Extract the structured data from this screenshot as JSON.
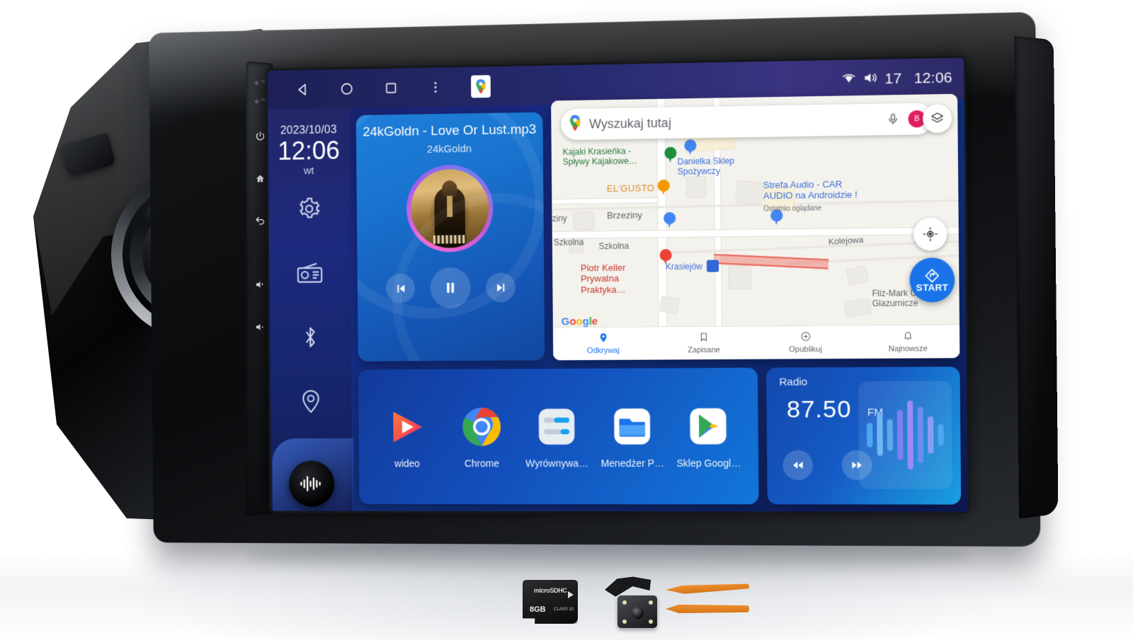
{
  "device": {
    "type": "android-car-head-unit",
    "hardware_buttons": [
      {
        "name": "power-button",
        "glyph": "⏻"
      },
      {
        "name": "home-button",
        "glyph": "⌂"
      },
      {
        "name": "back-button",
        "glyph": "↺"
      },
      {
        "name": "volume-up-button",
        "glyph": "🔊+"
      },
      {
        "name": "volume-down-button",
        "glyph": "🔈-"
      }
    ],
    "mic_label": "MIC"
  },
  "statusbar": {
    "nav": [
      {
        "name": "back-nav-icon",
        "label": "back"
      },
      {
        "name": "home-nav-icon",
        "label": "home"
      },
      {
        "name": "recents-nav-icon",
        "label": "recents"
      },
      {
        "name": "overflow-menu-icon",
        "label": "more"
      },
      {
        "name": "google-maps-app-icon",
        "label": "Maps"
      }
    ],
    "wifi_icon": "wifi",
    "volume_icon": "volume",
    "volume_level": "17",
    "clock": "12:06"
  },
  "rail": {
    "date": "2023/10/03",
    "time": "12:06",
    "weekday": "wt",
    "items": [
      {
        "name": "sidebar-item-settings",
        "icon": "gear-icon",
        "label": "Settings"
      },
      {
        "name": "sidebar-item-radio",
        "icon": "radio-icon",
        "label": "Radio"
      },
      {
        "name": "sidebar-item-bluetooth",
        "icon": "bluetooth-icon",
        "label": "Bluetooth"
      },
      {
        "name": "sidebar-item-navigation",
        "icon": "location-pin-icon",
        "label": "Navigation"
      }
    ],
    "voice_assistant_label": "Voice assistant"
  },
  "media": {
    "track_title": "24kGoldn - Love Or Lust.mp3",
    "artist": "24kGoldn",
    "prev_label": "Previous",
    "play_state": "paused",
    "pause_label": "Pause",
    "next_label": "Next"
  },
  "map": {
    "search_placeholder": "Wyszukaj tutaj",
    "avatar_initial": "B",
    "mic_label": "Voice search",
    "layers_label": "Layers",
    "locate_label": "Recenter",
    "start_label": "START",
    "attribution": "Google",
    "place_labels": [
      {
        "text": "Kajaki Krasieńka - Spływy Kajakowe…",
        "color": "green"
      },
      {
        "text": "Danielka Sklep Spożywczy",
        "color": "blue"
      },
      {
        "text": "Strefa Audio - CAR AUDIO na Androidzie !",
        "color": "blue"
      },
      {
        "text": "Ostatnio oglądane",
        "color": "grey"
      },
      {
        "text": "EL'GUSTO",
        "color": "orange"
      },
      {
        "text": "Piotr Keller Prywatna Praktyka…",
        "color": "red"
      },
      {
        "text": "Fliz-Mark Usługi Glazurnicze",
        "color": "grey"
      },
      {
        "text": "Krasiejów",
        "color": "blue"
      }
    ],
    "road_labels": [
      "ziny",
      "Brzeziny",
      "Szkolna",
      "Szkolna",
      "Kolejowa"
    ],
    "bottom_nav": [
      {
        "name": "mapnav-odkrywaj",
        "label": "Odkrywaj",
        "icon": "location-pin-icon",
        "active": true
      },
      {
        "name": "mapnav-zapisane",
        "label": "Zapisane",
        "icon": "bookmark-icon",
        "active": false
      },
      {
        "name": "mapnav-opublikuj",
        "label": "Opublikuj",
        "icon": "plus-circle-icon",
        "active": false
      },
      {
        "name": "mapnav-najnowsze",
        "label": "Najnowsze",
        "icon": "bell-icon",
        "active": false
      }
    ]
  },
  "apps": [
    {
      "name": "app-wideo",
      "label": "wideo",
      "icon": "video-play-icon"
    },
    {
      "name": "app-chrome",
      "label": "Chrome",
      "icon": "chrome-icon"
    },
    {
      "name": "app-wyrownywanie",
      "label": "Wyrównywa…",
      "icon": "equalizer-icon"
    },
    {
      "name": "app-menedzer-plikow",
      "label": "Menedżer P…",
      "icon": "file-manager-icon"
    },
    {
      "name": "app-sklep-google",
      "label": "Sklep Googl…",
      "icon": "play-store-icon"
    }
  ],
  "radio": {
    "title": "Radio",
    "frequency": "87.50",
    "band": "FM",
    "seek_down_label": "Seek down",
    "seek_up_label": "Seek up",
    "visualizer_bars": [
      34,
      58,
      44,
      70,
      96,
      78,
      52,
      30
    ]
  },
  "accessories": [
    {
      "name": "microsd-card",
      "capacity": "8GB",
      "logo": "microSDHC",
      "class": "CLASS 10"
    },
    {
      "name": "reverse-camera",
      "label": "Reverse camera"
    },
    {
      "name": "pry-tools",
      "label": "Pry tools"
    }
  ],
  "colors": {
    "screen_blue": "#1558b8",
    "accent_cyan": "#1a9fe0",
    "maps_blue": "#1a73e8",
    "avatar_pink": "#e01f62",
    "status_purple": "#3a3480"
  }
}
